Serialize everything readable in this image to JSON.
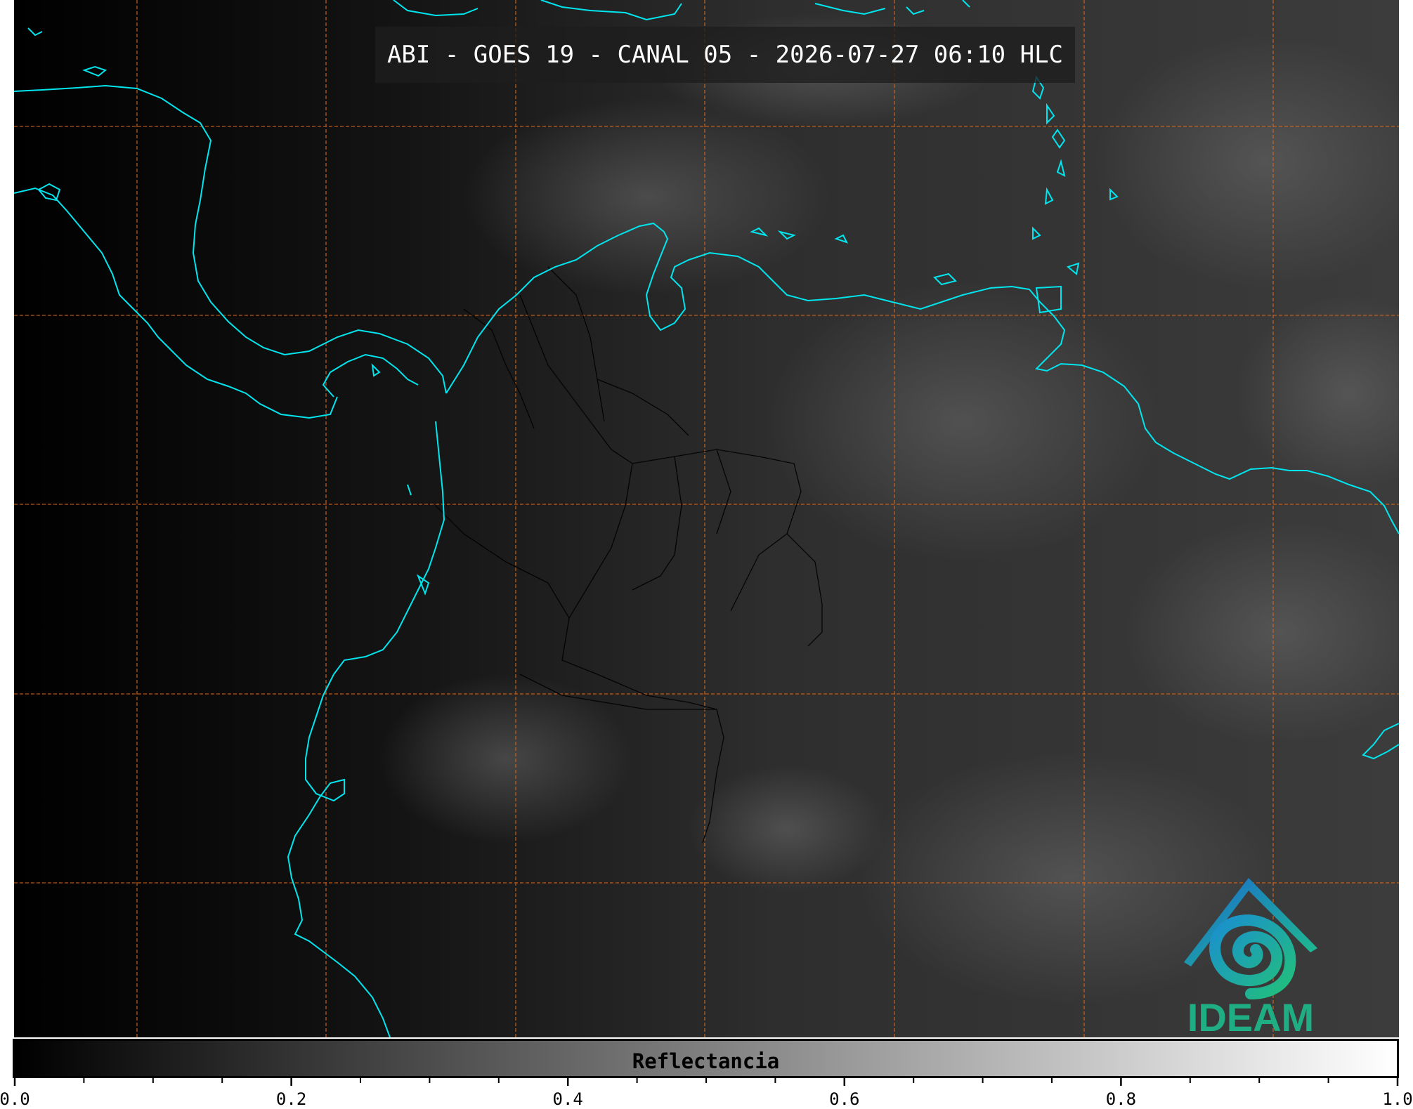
{
  "title": "ABI - GOES 19 - CANAL 05 - 2026-07-27 06:10 HLC",
  "colorbar": {
    "label": "Reflectancia",
    "ticks": [
      "0.0",
      "0.2",
      "0.4",
      "0.6",
      "0.8",
      "1.0"
    ],
    "range": [
      0.0,
      1.0
    ],
    "colors": [
      "#000000",
      "#ffffff"
    ]
  },
  "logo": {
    "text": "IDEAM"
  },
  "colors": {
    "coastline": "#00e5ee",
    "gridline": "#d2691e",
    "borders": "#000000"
  },
  "icons": [
    "ideam-logo-icon"
  ]
}
